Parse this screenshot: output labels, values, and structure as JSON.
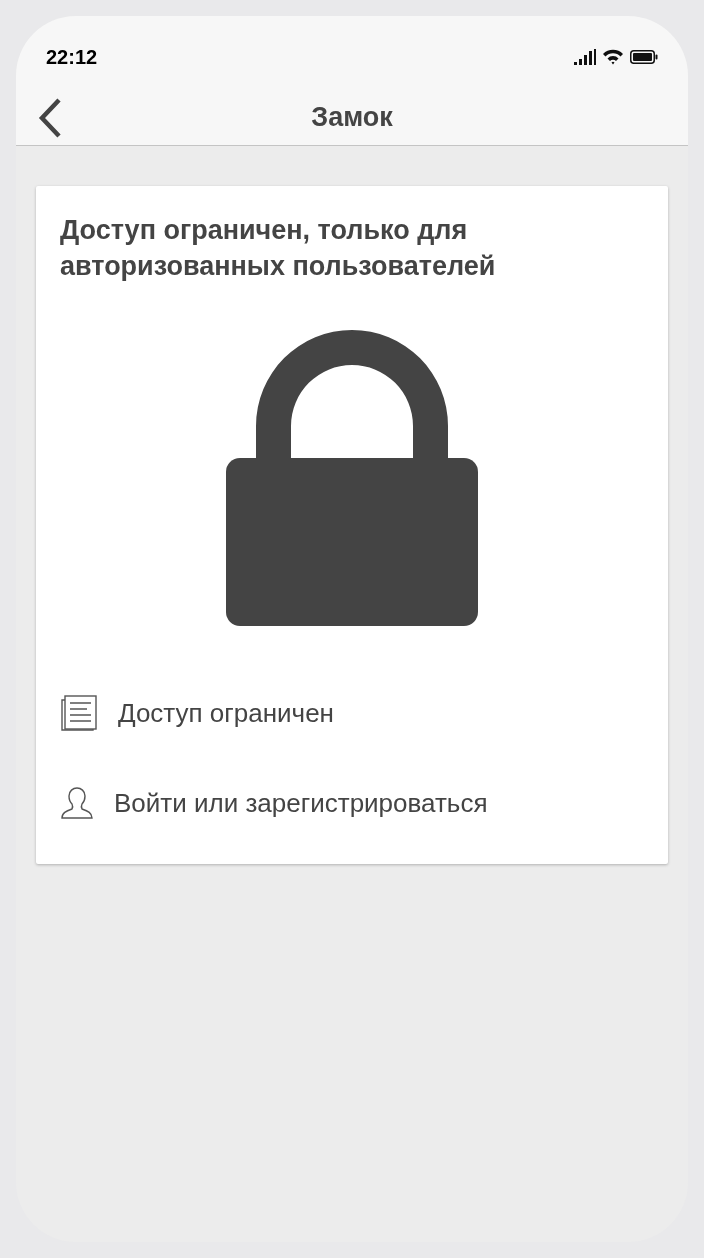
{
  "status_bar": {
    "time": "22:12"
  },
  "header": {
    "title": "Замок"
  },
  "card": {
    "heading": "Доступ ограничен, только для авторизованных пользователей",
    "items": [
      {
        "kind": "document",
        "label": "Доступ ограничен"
      },
      {
        "kind": "person",
        "label": "Войти или зарегистрироваться"
      }
    ]
  }
}
